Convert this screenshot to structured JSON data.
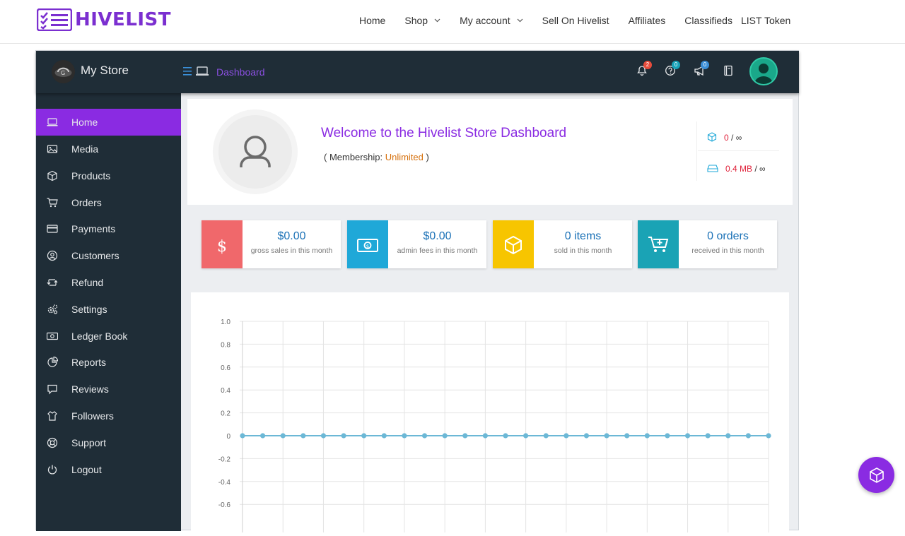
{
  "brand": {
    "name": "HIVELIST",
    "color": "#7b2fd0"
  },
  "topnav": {
    "items": [
      {
        "label": "Home",
        "dropdown": false
      },
      {
        "label": "Shop",
        "dropdown": true
      },
      {
        "label": "My account",
        "dropdown": true
      },
      {
        "label": "Sell On Hivelist",
        "dropdown": false
      },
      {
        "label": "Affiliates",
        "dropdown": false
      },
      {
        "label": "Classifieds",
        "dropdown": false
      }
    ],
    "last": "LIST Token"
  },
  "header": {
    "store_name": "My Store",
    "breadcrumb": "Dashboard",
    "notifications": {
      "icon": "bell-icon",
      "count": "2",
      "color": "#e74c3c"
    },
    "enquiries": {
      "icon": "question-icon",
      "count": "0",
      "color": "#17a2b8"
    },
    "announcements": {
      "icon": "megaphone-icon",
      "count": "0",
      "color": "#3b8fd8"
    },
    "knowledgebase": {
      "icon": "book-icon"
    }
  },
  "sidebar": {
    "items": [
      {
        "label": "Home",
        "icon": "laptop-icon",
        "active": true
      },
      {
        "label": "Media",
        "icon": "image-icon"
      },
      {
        "label": "Products",
        "icon": "cube-icon"
      },
      {
        "label": "Orders",
        "icon": "cart-icon"
      },
      {
        "label": "Payments",
        "icon": "credit-card-icon"
      },
      {
        "label": "Customers",
        "icon": "user-circle-icon"
      },
      {
        "label": "Refund",
        "icon": "retweet-icon"
      },
      {
        "label": "Settings",
        "icon": "cogs-icon"
      },
      {
        "label": "Ledger Book",
        "icon": "money-icon"
      },
      {
        "label": "Reports",
        "icon": "pie-chart-icon"
      },
      {
        "label": "Reviews",
        "icon": "comment-icon"
      },
      {
        "label": "Followers",
        "icon": "shirt-icon"
      },
      {
        "label": "Support",
        "icon": "life-ring-icon"
      },
      {
        "label": "Logout",
        "icon": "power-icon"
      }
    ]
  },
  "welcome": {
    "title": "Welcome to the Hivelist Store Dashboard",
    "membership_prefix": "( Membership: ",
    "membership_value": "Unlimited",
    "membership_suffix": " )",
    "products_used": "0",
    "products_limit": "/ ∞",
    "space_used": "0.4 MB",
    "space_limit": "/ ∞"
  },
  "cards": [
    {
      "value": "$0.00",
      "sub": "gross sales in this month",
      "color": "#f0686b",
      "icon": "dollar-icon"
    },
    {
      "value": "$0.00",
      "sub": "admin fees in this month",
      "color": "#1fa8d8",
      "icon": "money-bill-icon"
    },
    {
      "value": "0 items",
      "sub": "sold in this month",
      "color": "#f7c500",
      "icon": "cube-icon"
    },
    {
      "value": "0 orders",
      "sub": "received in this month",
      "color": "#1aa3b5",
      "icon": "cart-plus-icon"
    }
  ],
  "chart_data": {
    "type": "line",
    "ylim": [
      -0.8,
      1.0
    ],
    "yticks": [
      "1.0",
      "0.8",
      "0.6",
      "0.4",
      "0.2",
      "0",
      "-0.2",
      "-0.4",
      "-0.6"
    ],
    "series": [
      {
        "values": [
          0,
          0,
          0,
          0,
          0,
          0,
          0,
          0,
          0,
          0,
          0,
          0,
          0,
          0,
          0,
          0,
          0,
          0,
          0,
          0,
          0,
          0,
          0,
          0,
          0,
          0,
          0
        ],
        "color": "#6cb8d6"
      }
    ],
    "grid": true
  }
}
